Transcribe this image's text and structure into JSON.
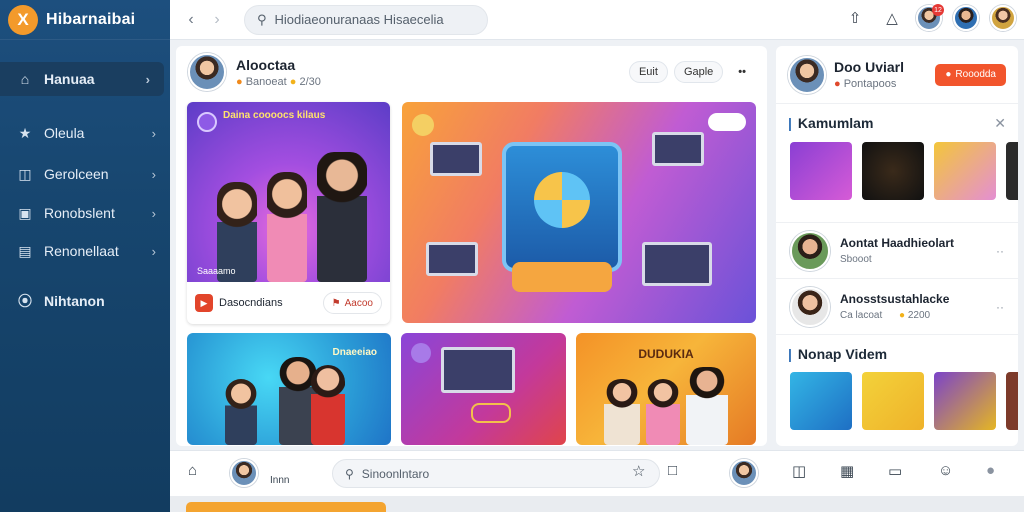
{
  "brand": {
    "name": "Hibarnaibai",
    "logo_letter": "Х"
  },
  "sidebar": {
    "items": [
      {
        "label": "Hanuaa",
        "icon": "home-icon"
      },
      {
        "label": "Oleula",
        "icon": "star-icon"
      },
      {
        "label": "Gerolceen",
        "icon": "bag-icon"
      },
      {
        "label": "Ronobslent",
        "icon": "grid-icon"
      },
      {
        "label": "Renonellaat",
        "icon": "chart-icon"
      },
      {
        "label": "Nihtanon",
        "icon": "compass-icon"
      }
    ]
  },
  "topbar": {
    "search_placeholder": "Hiodiaeonuranaas Hisaecelia",
    "badge_count": "12"
  },
  "post": {
    "author": "Alooctaa",
    "meta": "Banoeat",
    "meta_count": "2/30",
    "pill_one": "Euit",
    "pill_two": "Gaple",
    "more": "••"
  },
  "cards": {
    "card1_title": "Daina coooocs kilaus",
    "card1_tag": "Saaaamo",
    "card1_footer": "Dasocndians",
    "card1_button": "Aacoo",
    "card3_title": "Dnaeeiao",
    "card5_title": "DUDUKIA"
  },
  "rpanel": {
    "name": "Doo Uviarl",
    "meta": "Pontapoos",
    "action": "Rooodda",
    "section1": "Kamumlam",
    "rows": [
      {
        "title": "Aontat Haadhieolart",
        "sub": "Sbooot"
      },
      {
        "title": "Anosstsustahlacke",
        "sub": "Ca lacoat",
        "count": "2200"
      }
    ],
    "section2": "Nonap Videm"
  },
  "bottom": {
    "search_placeholder": "Sinoonlntaro",
    "label": "Innn"
  },
  "colors": {
    "sidebar": "#17466f",
    "accent": "#f39a2b",
    "action": "#f2552c"
  }
}
